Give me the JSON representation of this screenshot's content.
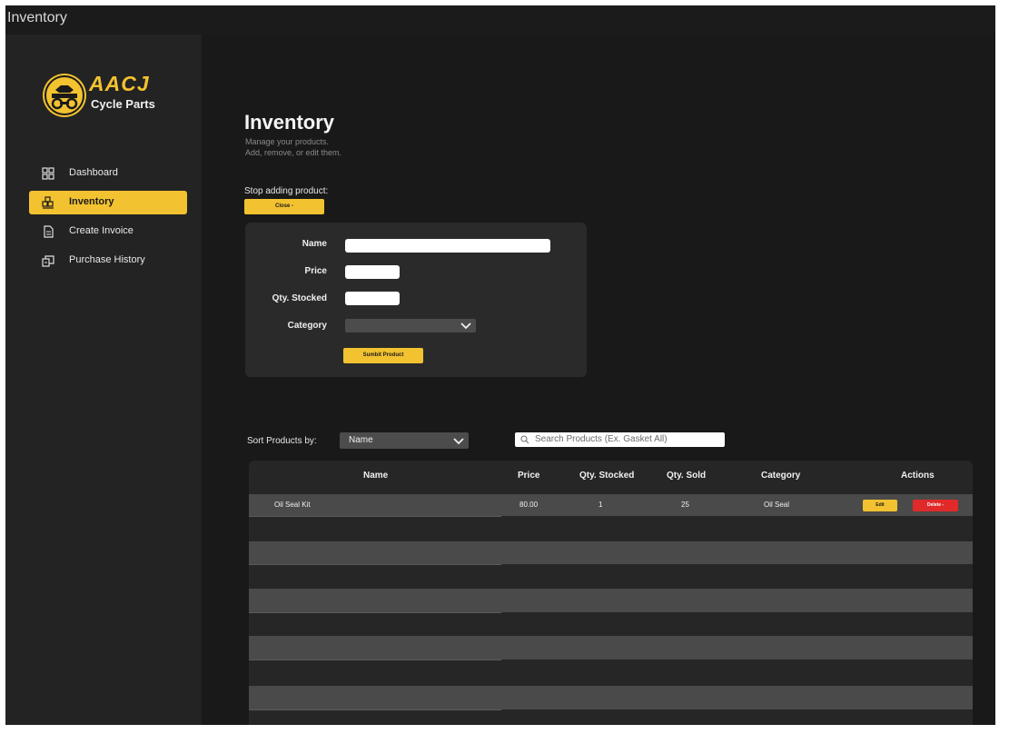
{
  "window": {
    "title": "Inventory"
  },
  "brand": {
    "name": "AACJ",
    "tagline": "Cycle Parts",
    "badge_text": "AACJ CYCLE PARTS",
    "accent_color": "#f2c230"
  },
  "nav": {
    "items": [
      {
        "label": "Dashboard",
        "icon": "dashboard-grid-icon",
        "active": false
      },
      {
        "label": "Inventory",
        "icon": "inventory-boxes-icon",
        "active": true
      },
      {
        "label": "Create Invoice",
        "icon": "invoice-document-icon",
        "active": false
      },
      {
        "label": "Purchase History",
        "icon": "purchase-history-icon",
        "active": false
      }
    ]
  },
  "page": {
    "title": "Inventory",
    "description_line1": "Manage your products.",
    "description_line2": "Add, remove, or edit them."
  },
  "add_product": {
    "stop_label": "Stop adding product:",
    "close_label": "Close -",
    "fields": {
      "name_label": "Name",
      "name_value": "",
      "price_label": "Price",
      "price_value": "",
      "qty_label": "Qty. Stocked",
      "qty_value": "",
      "category_label": "Category",
      "category_value": ""
    },
    "submit_label": "Sumbit Product"
  },
  "sort": {
    "label": "Sort Products by:",
    "selected": "Name"
  },
  "search": {
    "placeholder": "Search Products (Ex. Gasket All)",
    "value": ""
  },
  "table": {
    "columns": [
      "Name",
      "Price",
      "Qty. Stocked",
      "Qty. Sold",
      "Category",
      "Actions"
    ],
    "rows": [
      {
        "name": "Oil Seal Kit",
        "price": "80.00",
        "qty_stocked": "1",
        "qty_sold": "25",
        "category": "Oil Seal",
        "edit_label": "Edit",
        "delete_label": "Delete -"
      }
    ],
    "colors": {
      "row_fill": "#4a4a4a",
      "edit": "#f2c230",
      "delete": "#e02a2a"
    }
  }
}
